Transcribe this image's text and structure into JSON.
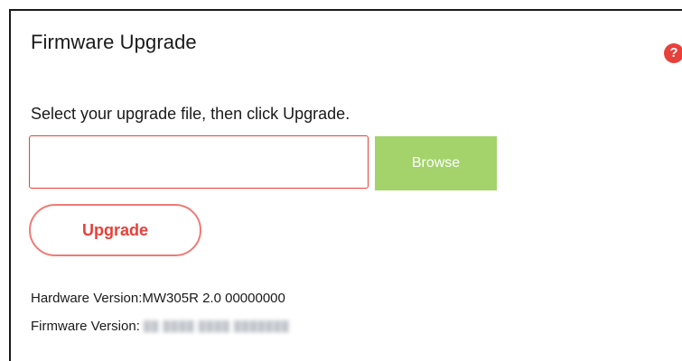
{
  "page": {
    "title": "Firmware Upgrade",
    "help_icon": "question-circle-icon"
  },
  "upgrade": {
    "instruction": "Select your upgrade file, then click Upgrade.",
    "file_value": "",
    "browse_label": "Browse",
    "upgrade_label": "Upgrade"
  },
  "versions": {
    "hardware_label": "Hardware Version:",
    "hardware_value": "MW305R 2.0 00000000",
    "firmware_label": "Firmware Version:"
  },
  "colors": {
    "accent_red": "#e8403a",
    "browse_green": "#a3d36a"
  }
}
